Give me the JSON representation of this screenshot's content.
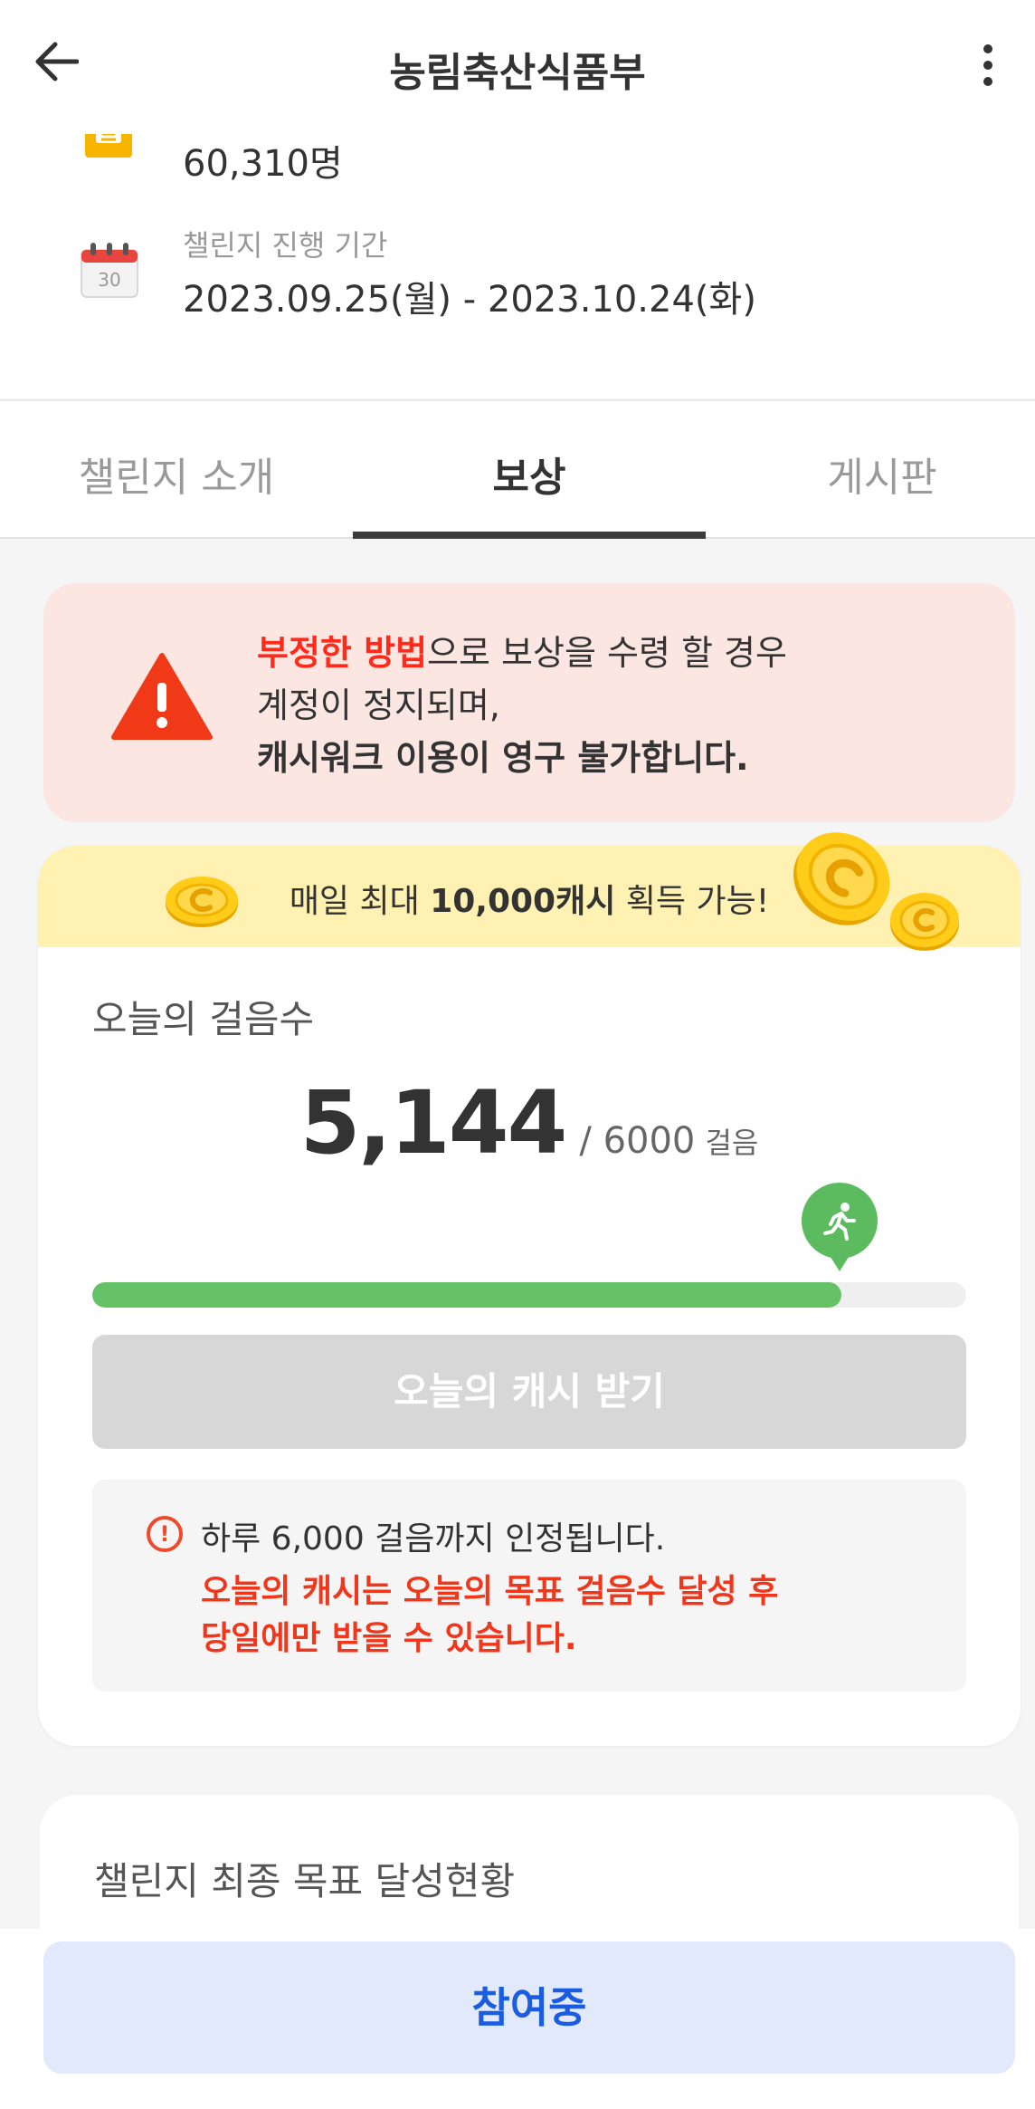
{
  "header": {
    "title": "농림축산식품부"
  },
  "info": {
    "participants": "60,310명",
    "period_label": "챌린지 진행 기간",
    "period_value": "2023.09.25(월) - 2023.10.24(화)",
    "calendar_day": "30"
  },
  "tabs": [
    {
      "label": "챌린지 소개",
      "active": false
    },
    {
      "label": "보상",
      "active": true
    },
    {
      "label": "게시판",
      "active": false
    }
  ],
  "warning": {
    "line1_red": "부정한 방법",
    "line1_rest": "으로 보상을 수령 할 경우",
    "line2": "계정이 정지되며,",
    "line3": "캐시워크 이용이 영구 불가합니다."
  },
  "reward": {
    "banner_prefix": "매일 최대 ",
    "banner_bold": "10,000캐시",
    "banner_suffix": " 획득 가능!",
    "steps_label": "오늘의 걸음수",
    "steps_value": "5,144",
    "steps_goal": "/ 6000",
    "steps_unit": "걸음",
    "progress": 0.857,
    "claim_label": "오늘의 캐시 받기",
    "notice_line1": "하루 6,000 걸음까지 인정됩니다.",
    "notice_line2": "오늘의 캐시는 오늘의 목표 걸음수 달성 후",
    "notice_line3": "당일에만 받을 수 있습니다."
  },
  "final": {
    "title": "챌린지 최종 목표 달성현황"
  },
  "bottom": {
    "join_label": "참여중"
  },
  "colors": {
    "accent_green": "#65c165",
    "warning_red": "#ff2a1a",
    "join_blue": "#1a5de0",
    "banner_yellow": "#fff1b2"
  }
}
